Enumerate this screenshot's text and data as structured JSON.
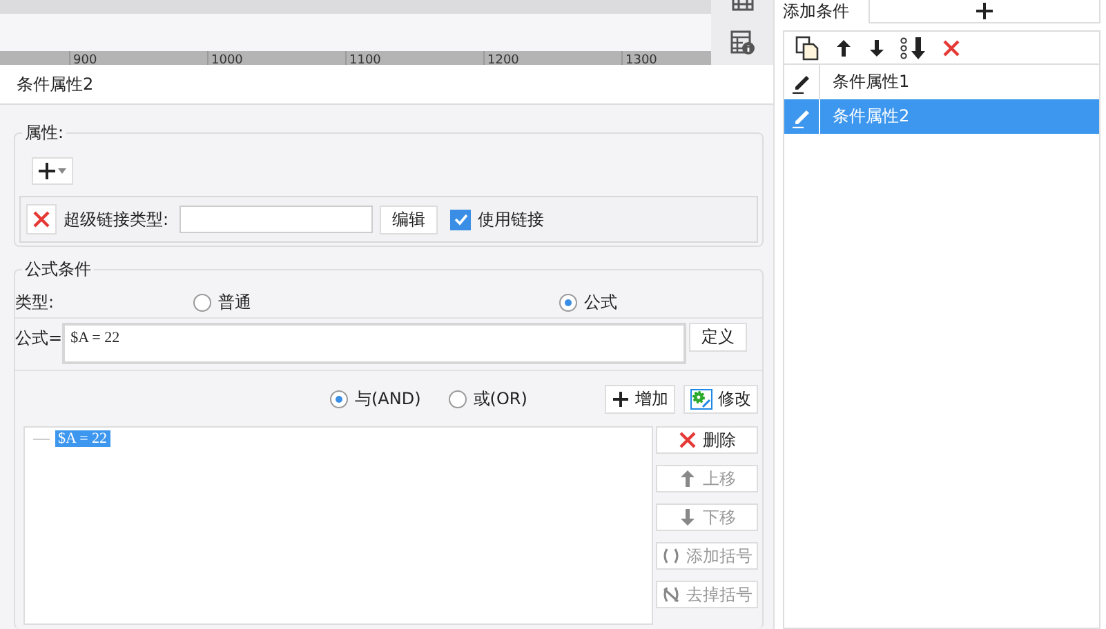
{
  "ruler": {
    "labels": [
      "900",
      "1000",
      "1100",
      "1200",
      "1300"
    ]
  },
  "title": "条件属性2",
  "properties": {
    "legend": "属性:",
    "link_row": {
      "label": "超级链接类型:",
      "edit_button": "编辑",
      "use_link": {
        "label": "使用链接",
        "checked": true
      }
    }
  },
  "formula_condition": {
    "legend": "公式条件",
    "type_label": "类型:",
    "type_options": [
      {
        "label": "普通",
        "selected": false
      },
      {
        "label": "公式",
        "selected": true
      }
    ],
    "formula_label": "公式=",
    "formula": "$A = 22",
    "define_button": "定义",
    "logic_options": [
      {
        "label": "与(AND)",
        "selected": true
      },
      {
        "label": "或(OR)",
        "selected": false
      }
    ],
    "add_button": "增加",
    "modify_button": "修改",
    "conditions": [
      {
        "text": "$A = 22",
        "selected": true
      }
    ],
    "side_buttons": [
      {
        "kind": "delete",
        "label": "删除",
        "disabled": false
      },
      {
        "kind": "up",
        "label": "上移",
        "disabled": true
      },
      {
        "kind": "down",
        "label": "下移",
        "disabled": true
      },
      {
        "kind": "add-paren",
        "label": "添加括号",
        "disabled": true
      },
      {
        "kind": "remove-paren",
        "label": "去掉括号",
        "disabled": true
      }
    ]
  },
  "right_panel": {
    "add_label": "添加条件",
    "items": [
      {
        "label": "条件属性1",
        "selected": false
      },
      {
        "label": "条件属性2",
        "selected": true
      }
    ]
  }
}
